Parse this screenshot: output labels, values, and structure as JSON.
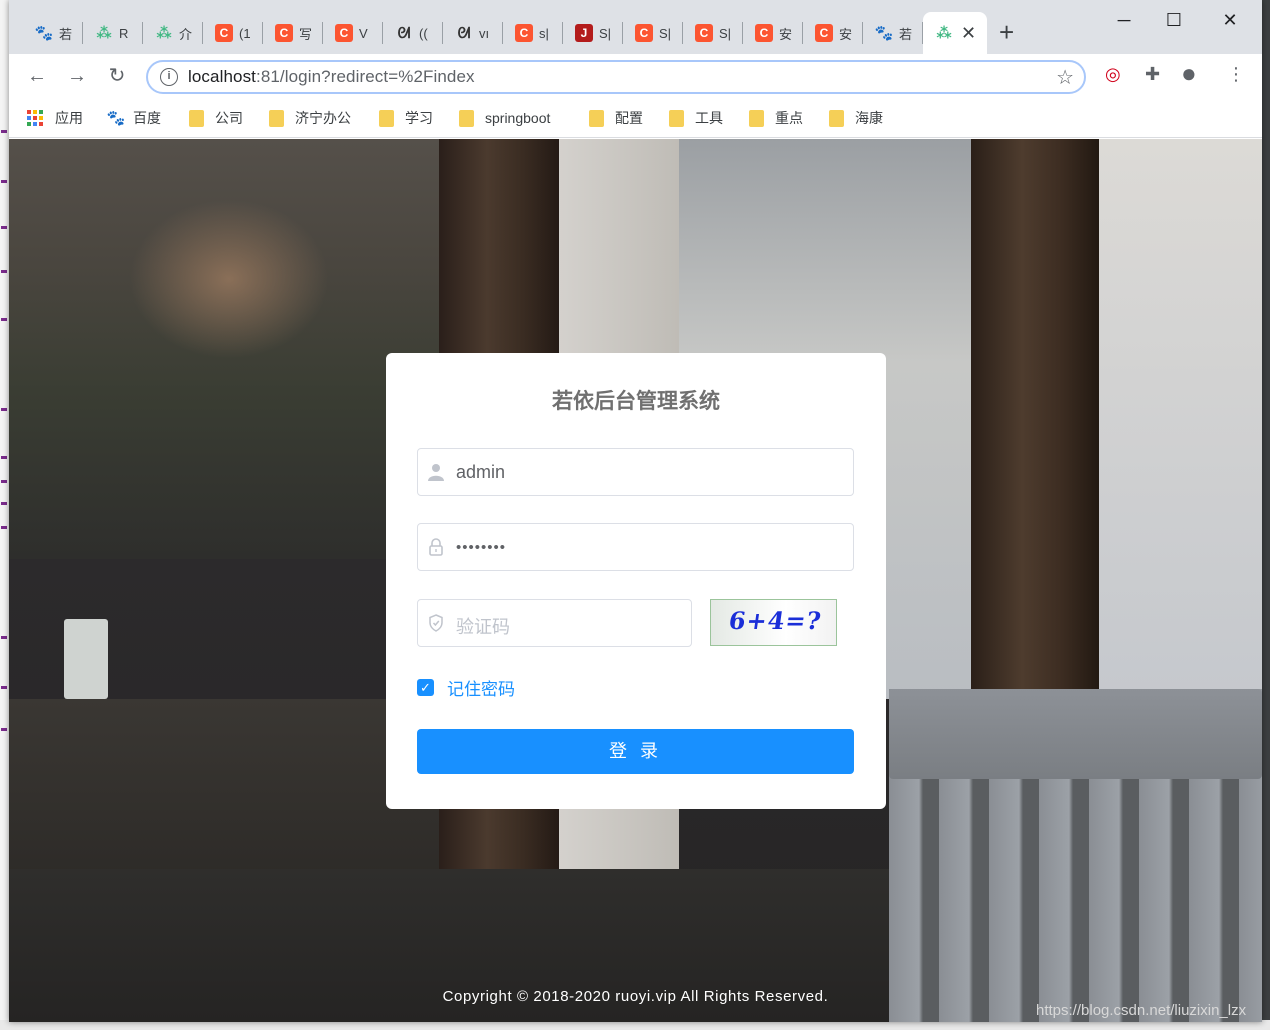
{
  "tabs": [
    {
      "icon": "baidu-icon",
      "label": "若"
    },
    {
      "icon": "leaf-icon",
      "label": "R"
    },
    {
      "icon": "leaf-icon",
      "label": "介"
    },
    {
      "icon": "csdn-icon",
      "label": "(1"
    },
    {
      "icon": "csdn-icon",
      "label": "写"
    },
    {
      "icon": "csdn-icon",
      "label": "V"
    },
    {
      "icon": "vuepress-icon",
      "label": "(("
    },
    {
      "icon": "vuepress-icon",
      "label": "vı"
    },
    {
      "icon": "csdn-icon",
      "label": "s|"
    },
    {
      "icon": "jianshu-icon",
      "label": "S|"
    },
    {
      "icon": "csdn-icon",
      "label": "S|"
    },
    {
      "icon": "csdn-icon",
      "label": "S|"
    },
    {
      "icon": "csdn-icon",
      "label": "安"
    },
    {
      "icon": "csdn-icon",
      "label": "安"
    },
    {
      "icon": "baidu-icon",
      "label": "若"
    },
    {
      "icon": "leaf-icon",
      "label": ""
    }
  ],
  "fav_letters": {
    "csdn": "C",
    "jianshu": "J",
    "baidu": "🐾",
    "leaf": "⁂",
    "vuepress": "ᘛ"
  },
  "window": {
    "minimize": "─",
    "maximize": "☐",
    "close": "✕",
    "new_tab": "+",
    "tab_close": "✕"
  },
  "toolbar": {
    "back": "←",
    "forward": "→",
    "reload": "↻",
    "url_host": "localhost",
    "url_rest": ":81/login?redirect=%2Findex",
    "info": "i",
    "star": "☆",
    "ext_icons": [
      "◎",
      "✚",
      "●",
      "⋮"
    ]
  },
  "bookmarks": [
    {
      "icon": "apps-icon",
      "label": "应用"
    },
    {
      "icon": "baidu-icon",
      "label": "百度"
    },
    {
      "icon": "folder-icon",
      "label": "公司"
    },
    {
      "icon": "folder-icon",
      "label": "济宁办公"
    },
    {
      "icon": "folder-icon",
      "label": "学习"
    },
    {
      "icon": "folder-icon",
      "label": "springboot"
    },
    {
      "icon": "folder-icon",
      "label": "配置"
    },
    {
      "icon": "folder-icon",
      "label": "工具"
    },
    {
      "icon": "folder-icon",
      "label": "重点"
    },
    {
      "icon": "folder-icon",
      "label": "海康"
    }
  ],
  "login": {
    "title": "若依后台管理系统",
    "username": "admin",
    "password": "••••••••",
    "captcha_placeholder": "验证码",
    "captcha_text": "6+4=?",
    "remember_label": "记住密码",
    "remember_checked": true,
    "submit_label": "登 录"
  },
  "footer": "Copyright © 2018-2020 ruoyi.vip All Rights Reserved.",
  "watermark": "https://blog.csdn.net/liuzixin_lzx",
  "colors": {
    "primary": "#1890ff",
    "tabstrip": "#dee1e6",
    "csdn": "#fc5531"
  }
}
